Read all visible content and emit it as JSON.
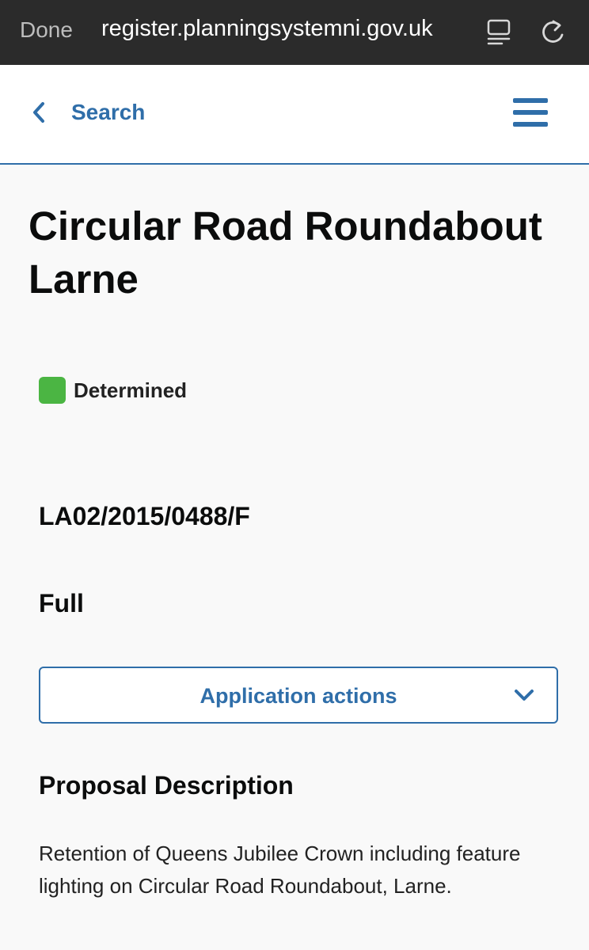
{
  "browser": {
    "done_label": "Done",
    "url": "register.planningsystemni.gov.uk",
    "icons": [
      "reader-icon",
      "reload-icon"
    ]
  },
  "header": {
    "back_label": "Search",
    "icons": [
      "chevron-left-icon",
      "hamburger-menu-icon"
    ]
  },
  "application": {
    "title": "Circular Road Roundabout Larne",
    "status": "Determined",
    "status_color": "#4bb543",
    "reference": "LA02/2015/0488/F",
    "type": "Full",
    "actions_label": "Application actions",
    "proposal_heading": "Proposal Description",
    "proposal_text": "Retention of Queens Jubilee Crown including feature lighting on Circular Road Roundabout, Larne."
  },
  "colors": {
    "accent": "#2f6ea9",
    "browser_bar": "#2b2b2b",
    "page_background": "#f9f9f9"
  }
}
